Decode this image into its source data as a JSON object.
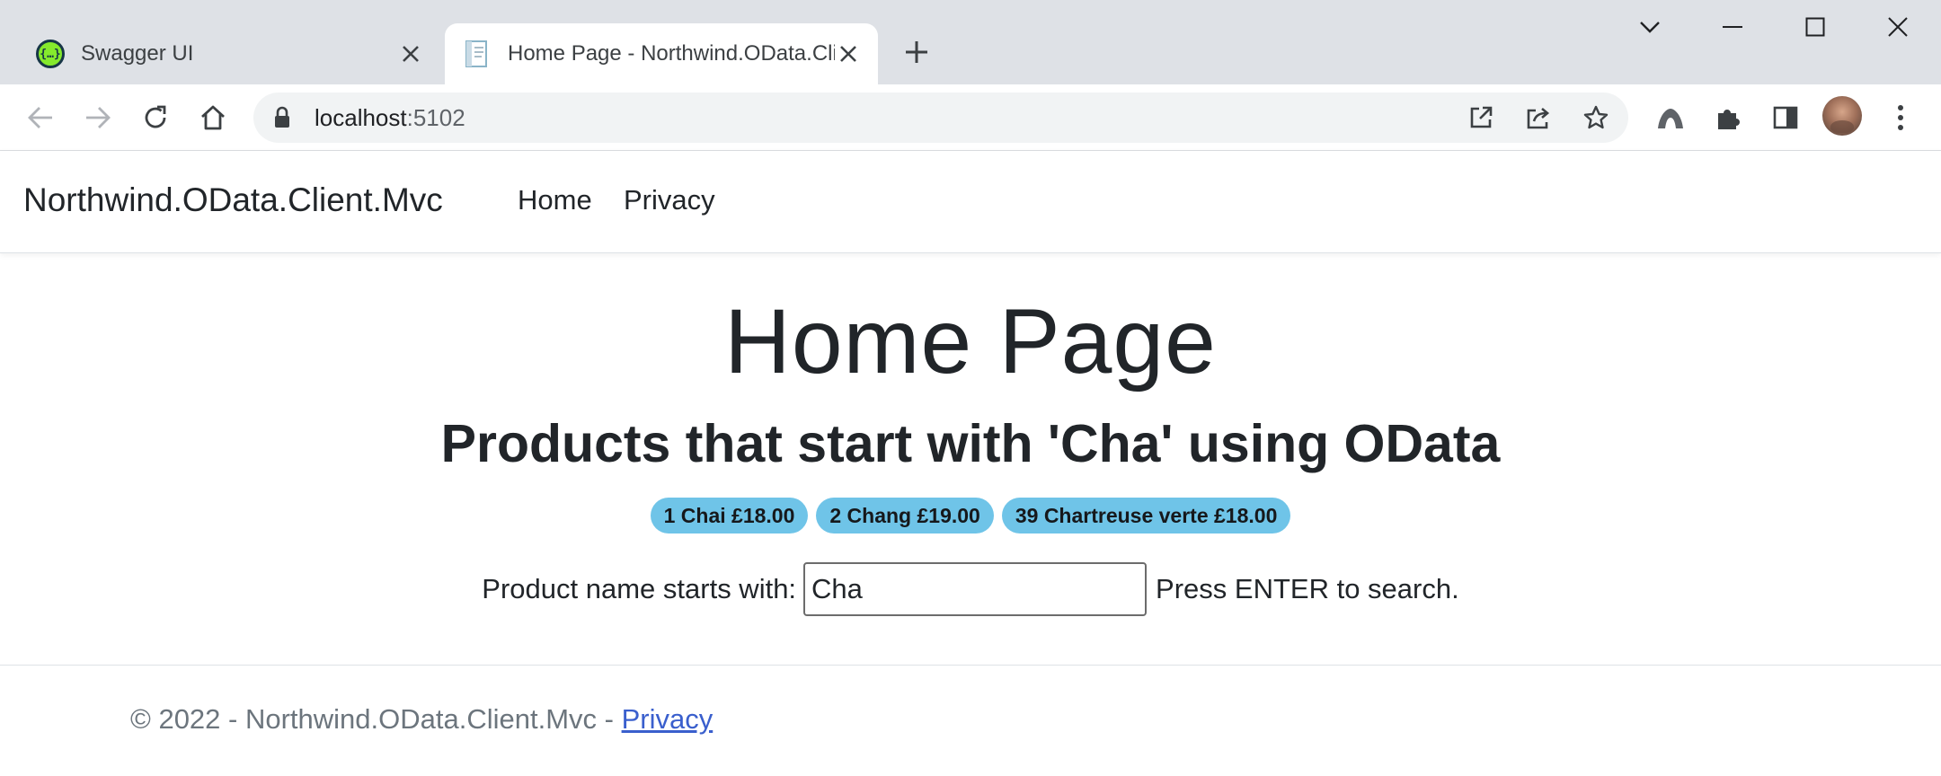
{
  "browser": {
    "tabs": [
      {
        "title": "Swagger UI",
        "icon": "swagger-icon",
        "active": false
      },
      {
        "title": "Home Page - Northwind.OData.Client.Mvc",
        "icon": "page-icon",
        "active": true
      }
    ],
    "address": {
      "host": "localhost",
      "port": ":5102"
    }
  },
  "site": {
    "brand": "Northwind.OData.Client.Mvc",
    "nav": {
      "home": "Home",
      "privacy": "Privacy"
    }
  },
  "main": {
    "title": "Home Page",
    "subtitle": "Products that start with 'Cha' using OData",
    "products": [
      {
        "label": "1 Chai £18.00"
      },
      {
        "label": "2 Chang £19.00"
      },
      {
        "label": "39 Chartreuse verte £18.00"
      }
    ],
    "search": {
      "label": "Product name starts with:",
      "value": "Cha",
      "hint": "Press ENTER to search."
    }
  },
  "footer": {
    "text": "© 2022 - Northwind.OData.Client.Mvc - ",
    "link": "Privacy"
  },
  "colors": {
    "badge": "#6fc4e8",
    "link": "#3a5fcd",
    "swagger": "#85ea2d"
  }
}
